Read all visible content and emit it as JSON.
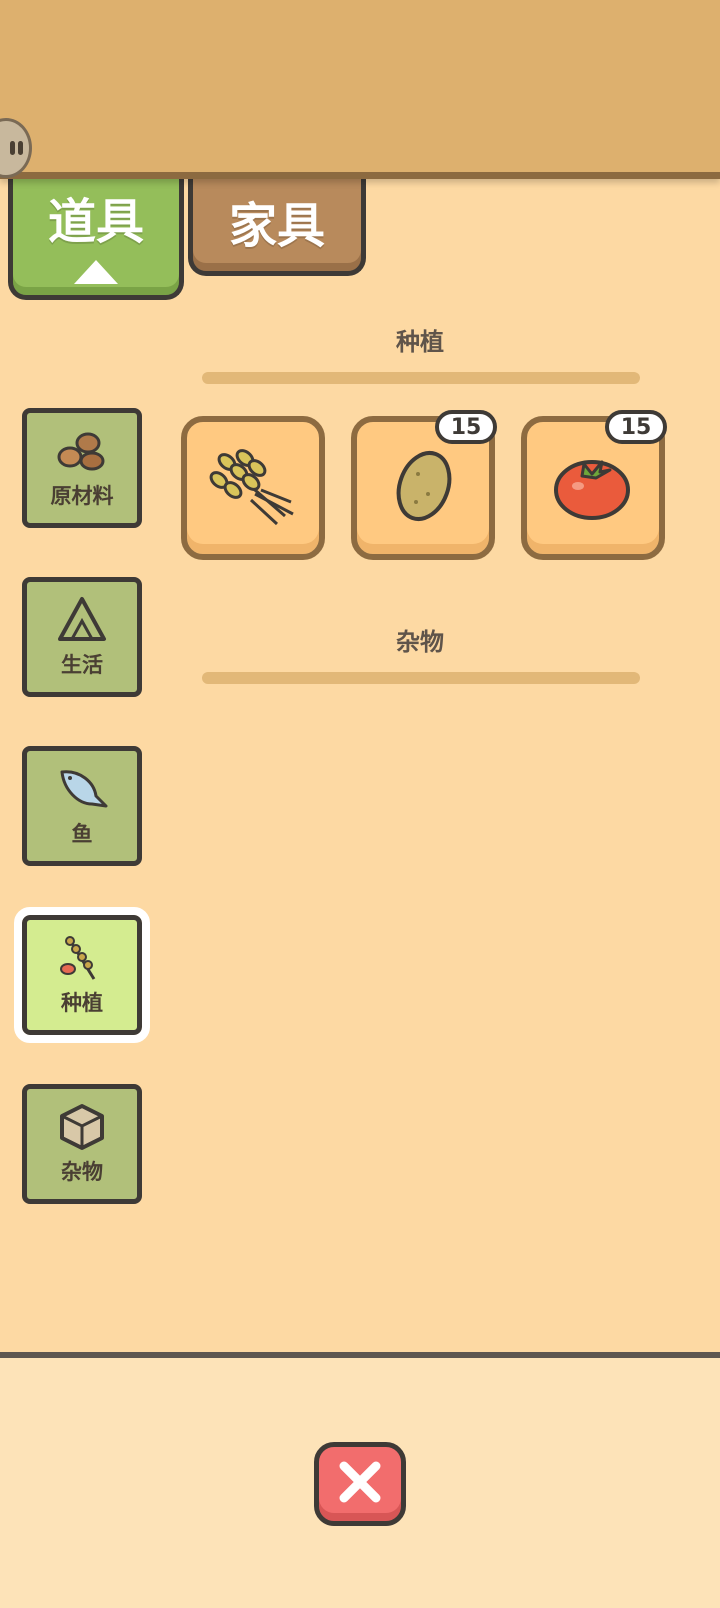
{
  "tabs": {
    "props_label": "道具",
    "furniture_label": "家具"
  },
  "sidebar": {
    "items": [
      {
        "label": "原材料",
        "icon": "nuts-icon"
      },
      {
        "label": "生活",
        "icon": "onigiri-icon"
      },
      {
        "label": "鱼",
        "icon": "fish-icon"
      },
      {
        "label": "种植",
        "icon": "plant-icon",
        "selected": true
      },
      {
        "label": "杂物",
        "icon": "box-icon"
      }
    ]
  },
  "sections": {
    "planting": {
      "title": "种植",
      "items": [
        {
          "icon": "wheat-icon",
          "count": ""
        },
        {
          "icon": "potato-icon",
          "count": "15"
        },
        {
          "icon": "tomato-icon",
          "count": "15"
        }
      ]
    },
    "misc": {
      "title": "杂物"
    }
  },
  "colors": {
    "background": "#fdd9a3",
    "banner": "#ddb06e",
    "tab_active": "#94be5a",
    "tab_inactive": "#b88a5c",
    "sidebar_button": "#b1c07a",
    "sidebar_selected": "#d4ec90",
    "item_slot": "#ffc981",
    "close_button": "#f26d6d"
  }
}
